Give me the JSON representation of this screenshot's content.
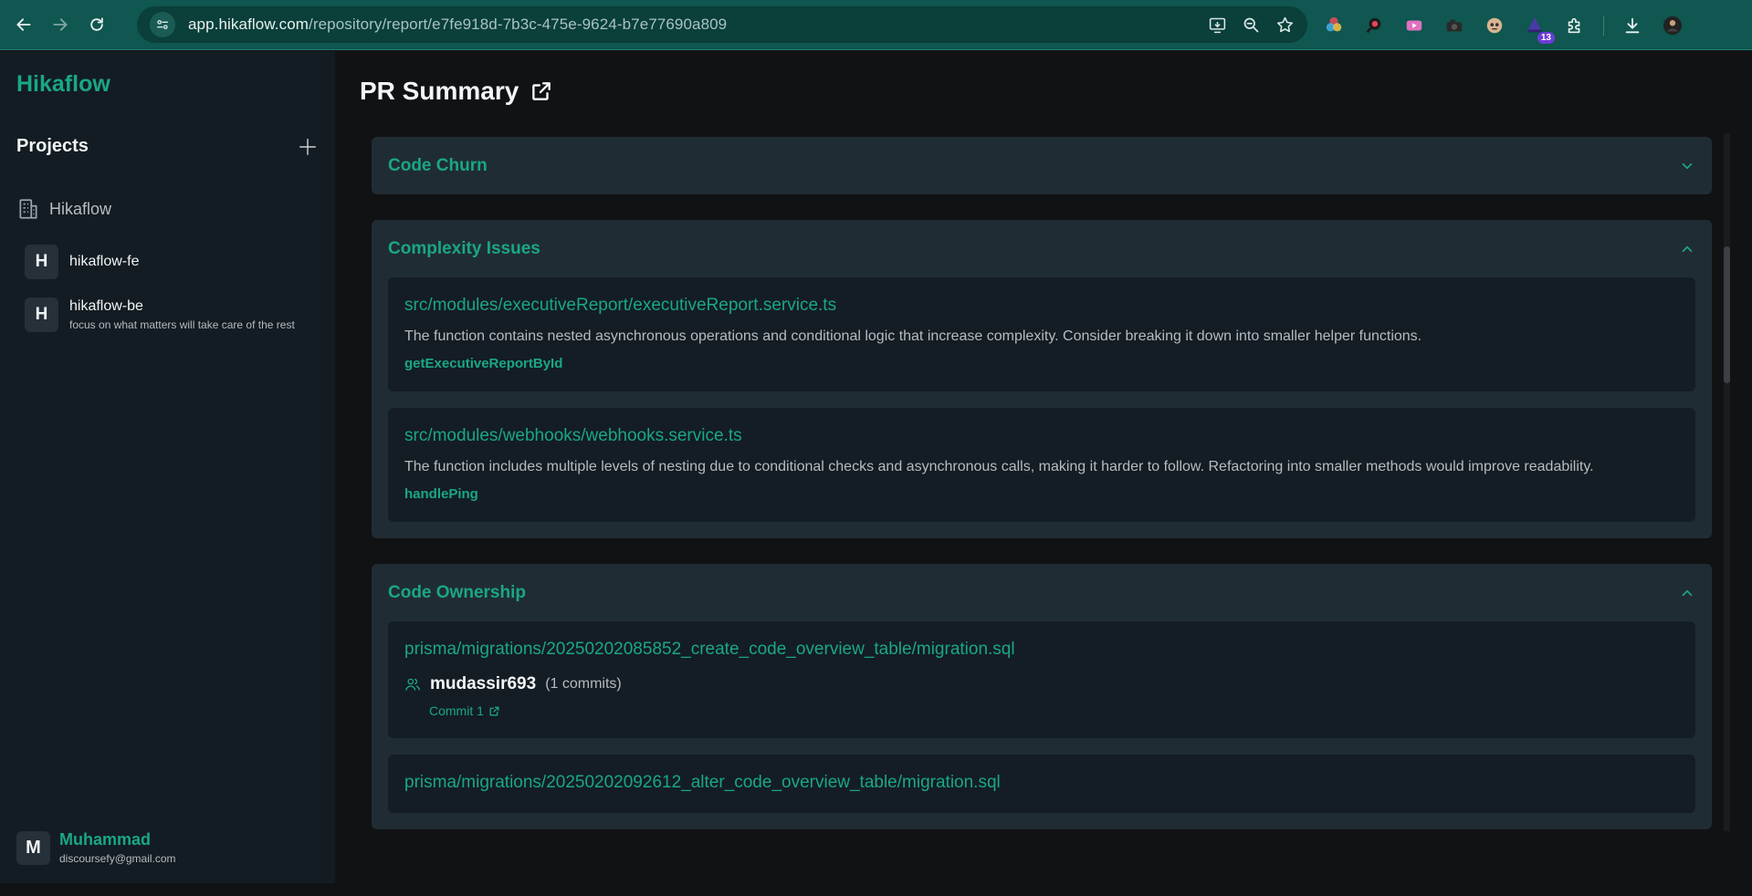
{
  "browser": {
    "url_host": "app.hikaflow.com",
    "url_path": "/repository/report/e7fe918d-7b3c-475e-9624-b7e77690a809",
    "extension_badge": "13"
  },
  "sidebar": {
    "brand": "Hikaflow",
    "projects_title": "Projects",
    "org_name": "Hikaflow",
    "repos": [
      {
        "letter": "H",
        "name": "hikaflow-fe",
        "desc": ""
      },
      {
        "letter": "H",
        "name": "hikaflow-be",
        "desc": "focus on what matters will take care of the rest"
      }
    ],
    "user": {
      "letter": "M",
      "name": "Muhammad",
      "email": "discoursefy@gmail.com"
    }
  },
  "main": {
    "title": "PR Summary",
    "sections": {
      "code_churn": {
        "title": "Code Churn"
      },
      "complexity": {
        "title": "Complexity Issues",
        "items": [
          {
            "file": "src/modules/executiveReport/executiveReport.service.ts",
            "desc": "The function contains nested asynchronous operations and conditional logic that increase complexity. Consider breaking it down into smaller helper functions.",
            "fn": "getExecutiveReportById"
          },
          {
            "file": "src/modules/webhooks/webhooks.service.ts",
            "desc": "The function includes multiple levels of nesting due to conditional checks and asynchronous calls, making it harder to follow. Refactoring into smaller methods would improve readability.",
            "fn": "handlePing"
          }
        ]
      },
      "ownership": {
        "title": "Code Ownership",
        "items": [
          {
            "file": "prisma/migrations/20250202085852_create_code_overview_table/migration.sql",
            "owner": "mudassir693",
            "count": "(1 commits)",
            "commit": "Commit 1"
          },
          {
            "file": "prisma/migrations/20250202092612_alter_code_overview_table/migration.sql"
          }
        ]
      }
    }
  }
}
